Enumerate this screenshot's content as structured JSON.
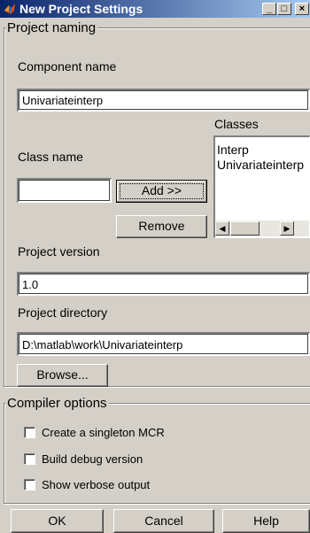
{
  "window": {
    "title": "New Project Settings",
    "icon": "matlab-icon",
    "controls": {
      "minimize": "_",
      "maximize": "□",
      "close": "×"
    }
  },
  "project_naming": {
    "legend": "Project naming",
    "component_name_label": "Component name",
    "component_name_value": "Univariateinterp",
    "classes_label": "Classes",
    "class_name_label": "Class name",
    "class_name_value": "",
    "add_button": "Add >>",
    "remove_button": "Remove",
    "classes": [
      "Interp",
      "Univariateinterp"
    ],
    "project_version_label": "Project version",
    "project_version_value": "1.0",
    "project_directory_label": "Project directory",
    "project_directory_value": "D:\\matlab\\work\\Univariateinterp",
    "browse_button": "Browse..."
  },
  "compiler_options": {
    "legend": "Compiler options",
    "options": [
      {
        "label": "Create a singleton MCR",
        "checked": false
      },
      {
        "label": "Build debug version",
        "checked": false
      },
      {
        "label": "Show verbose output",
        "checked": false
      }
    ]
  },
  "footer": {
    "ok": "OK",
    "cancel": "Cancel",
    "help": "Help"
  },
  "colors": {
    "face": "#d4d0c8",
    "title_start": "#0a246a",
    "title_end": "#a6caf0"
  }
}
